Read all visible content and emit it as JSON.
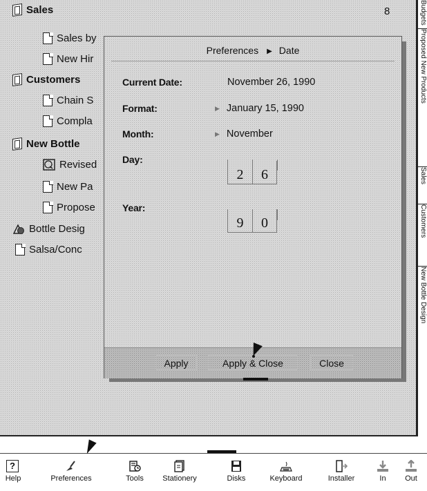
{
  "toc": {
    "items": [
      {
        "label": "Sales",
        "kind": "section",
        "page": "8"
      },
      {
        "label": "Sales by",
        "kind": "doc",
        "page": ""
      },
      {
        "label": "New Hir",
        "kind": "doc",
        "page": ""
      },
      {
        "label": "Customers",
        "kind": "section",
        "page": ""
      },
      {
        "label": "Chain S",
        "kind": "doc",
        "page": ""
      },
      {
        "label": "Compla",
        "kind": "doc",
        "page": ""
      },
      {
        "label": "New Bottle",
        "kind": "section",
        "page": ""
      },
      {
        "label": "Revised",
        "kind": "reply",
        "page": ""
      },
      {
        "label": "New Pa",
        "kind": "doc",
        "page": ""
      },
      {
        "label": "Propose",
        "kind": "doc",
        "page": ""
      },
      {
        "label": "Bottle Desig",
        "kind": "shapes",
        "page": ""
      },
      {
        "label": "Salsa/Conc",
        "kind": "doc",
        "page": ""
      }
    ]
  },
  "tabs": [
    {
      "label": "Budgets"
    },
    {
      "label": "Proposed New Products"
    },
    {
      "label": "Sales"
    },
    {
      "label": "Customers"
    },
    {
      "label": "New Bottle Design"
    }
  ],
  "dialog": {
    "title_parent": "Preferences",
    "title_child": "Date",
    "current_date_label": "Current Date:",
    "current_date_value": "November 26, 1990",
    "format_label": "Format:",
    "format_value": "January 15, 1990",
    "month_label": "Month:",
    "month_value": "November",
    "day_label": "Day:",
    "day_digits": [
      "2",
      "6"
    ],
    "year_label": "Year:",
    "year_digits": [
      "9",
      "0"
    ],
    "buttons": {
      "apply": "Apply",
      "apply_close": "Apply & Close",
      "close": "Close"
    }
  },
  "toolbar": {
    "items": [
      {
        "label": "Help",
        "icon": "help-icon"
      },
      {
        "label": "Preferences",
        "icon": "preferences-icon"
      },
      {
        "label": "Tools",
        "icon": "tools-icon"
      },
      {
        "label": "Stationery",
        "icon": "stationery-icon"
      },
      {
        "label": "Disks",
        "icon": "disks-icon"
      },
      {
        "label": "Keyboard",
        "icon": "keyboard-icon"
      },
      {
        "label": "Installer",
        "icon": "installer-icon"
      },
      {
        "label": "In",
        "icon": "in-box-icon"
      },
      {
        "label": "Out",
        "icon": "out-box-icon"
      }
    ]
  }
}
